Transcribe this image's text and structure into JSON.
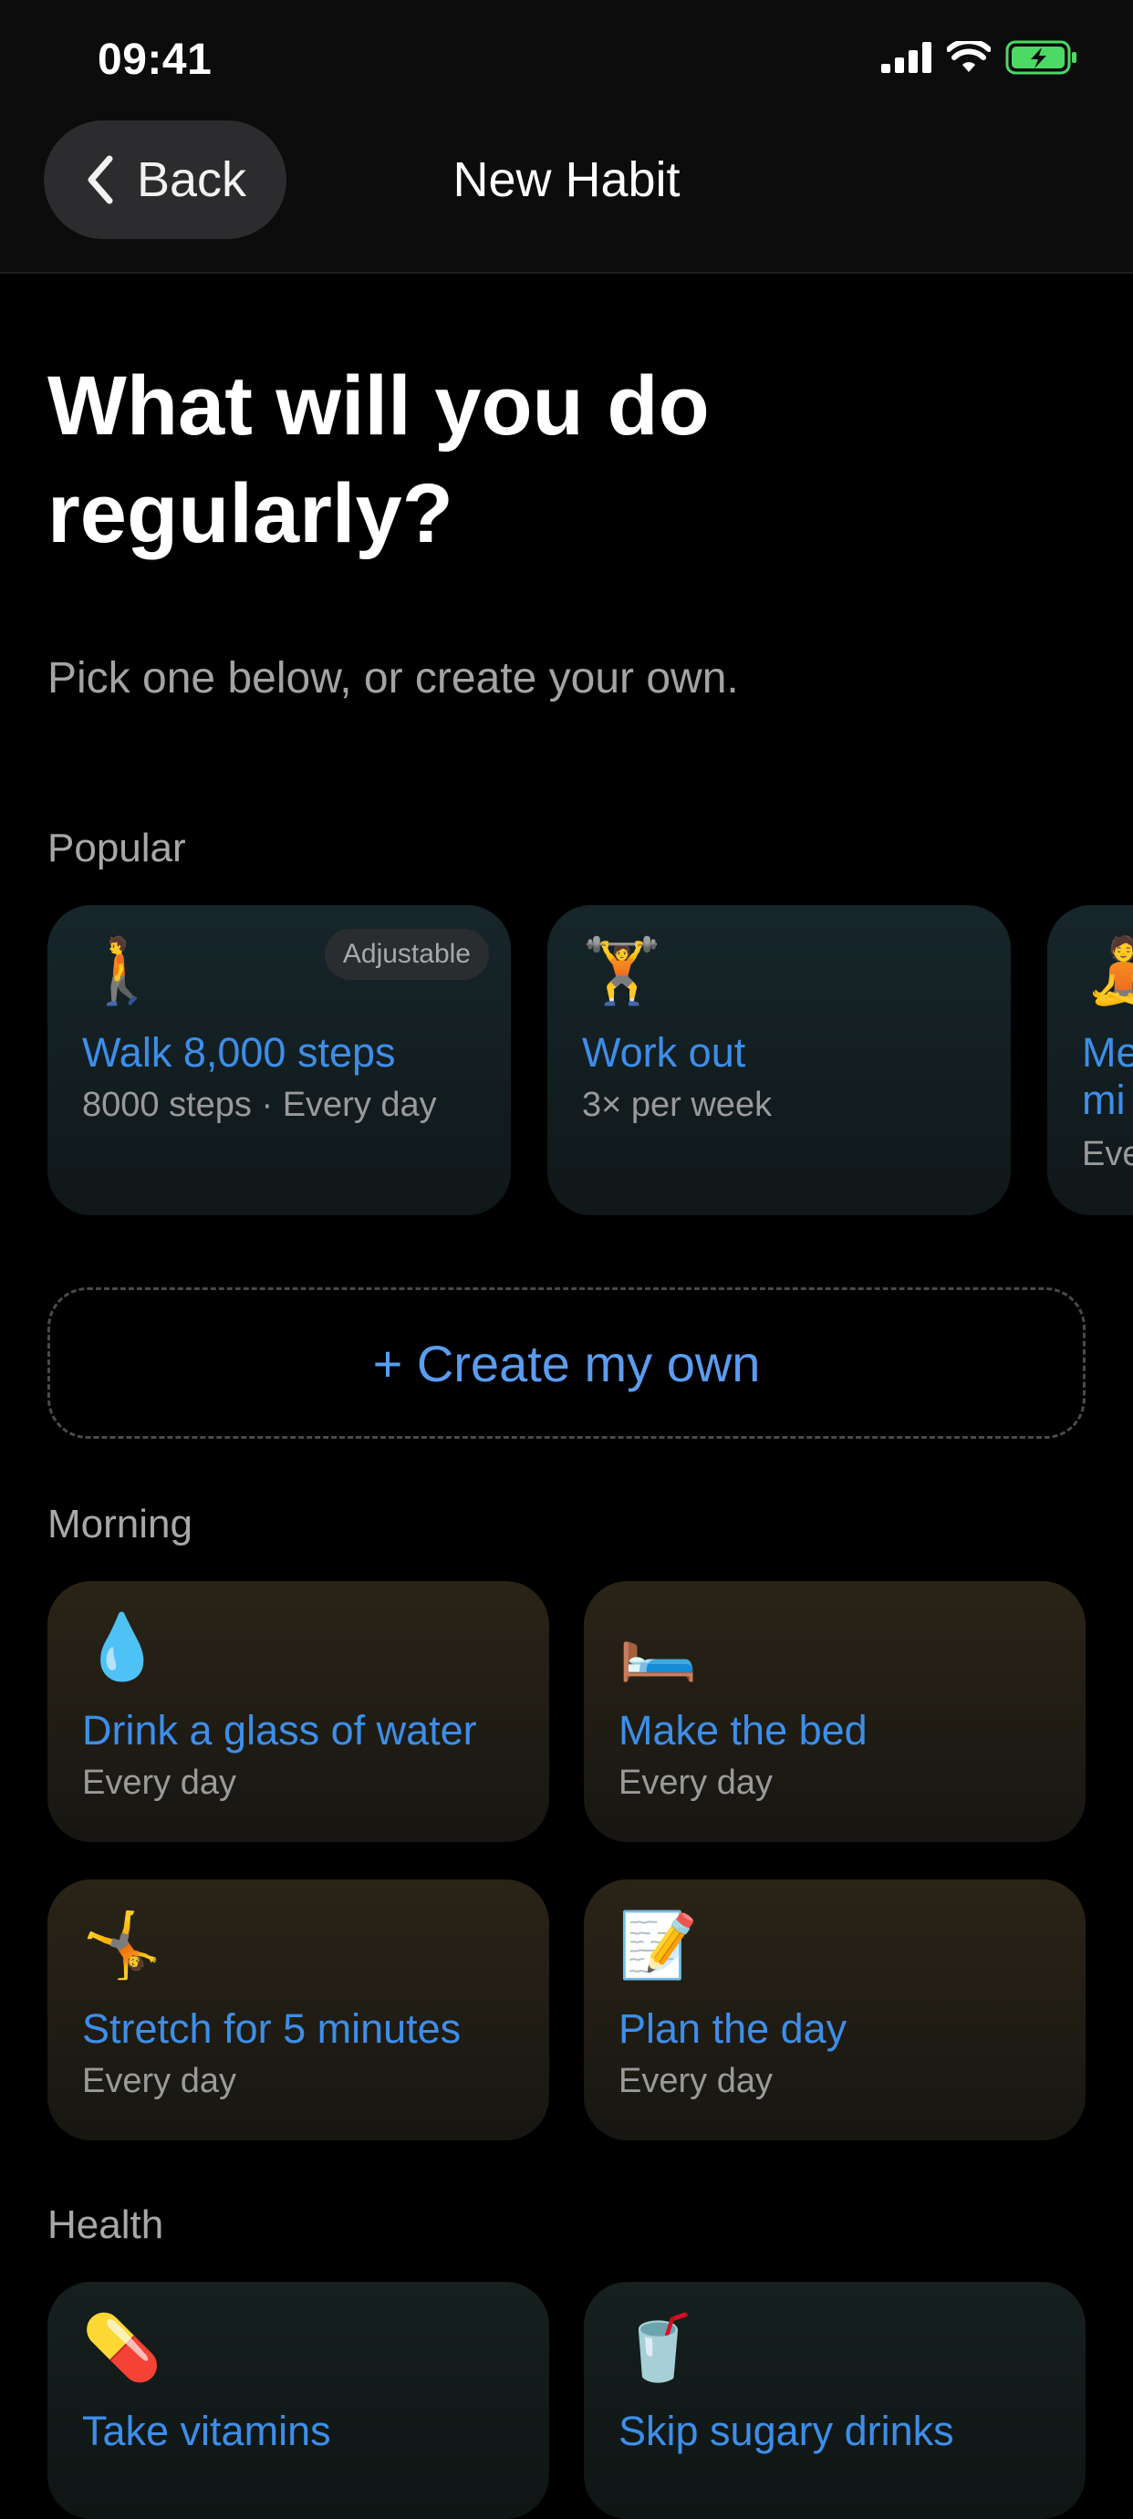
{
  "status_bar": {
    "time": "09:41"
  },
  "nav": {
    "back_label": "Back",
    "title": "New Habit"
  },
  "header": {
    "headline": "What will you do regularly?",
    "subtitle": "Pick one below, or create your own."
  },
  "popular": {
    "title": "Popular",
    "items": [
      {
        "emoji": "🚶",
        "title": "Walk 8,000 steps",
        "subtitle": "8000 steps · Every day",
        "badge": "Adjustable"
      },
      {
        "emoji": "🏋️",
        "title": "Work out",
        "subtitle": "3× per week"
      },
      {
        "emoji": "🧘",
        "title": "Me mi",
        "subtitle": "Eve"
      }
    ]
  },
  "create_own": {
    "label": "+ Create my own"
  },
  "morning": {
    "title": "Morning",
    "items": [
      {
        "emoji": "💧",
        "title": "Drink a glass of water",
        "subtitle": "Every day"
      },
      {
        "emoji": "🛏️",
        "title": "Make the bed",
        "subtitle": "Every day"
      },
      {
        "emoji": "🤸",
        "title": "Stretch for 5 minutes",
        "subtitle": "Every day"
      },
      {
        "emoji": "📝",
        "title": "Plan the day",
        "subtitle": "Every day"
      }
    ]
  },
  "health": {
    "title": "Health",
    "items": [
      {
        "emoji": "💊",
        "title": "Take vitamins"
      },
      {
        "emoji": "🥤",
        "title": "Skip sugary drinks"
      }
    ]
  },
  "icons": [
    "chevron-left-icon",
    "signal-icon",
    "wifi-icon",
    "battery-charging-icon"
  ],
  "colors": {
    "accent": "#3e8ee8",
    "battery": "#4cd964",
    "background": "#000000"
  }
}
